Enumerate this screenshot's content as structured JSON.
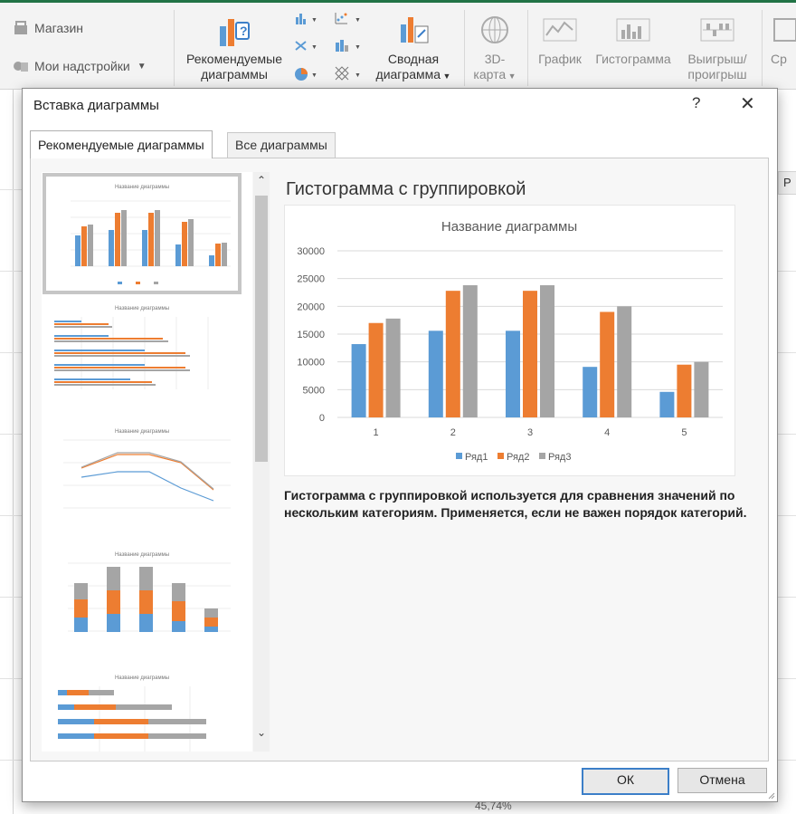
{
  "ribbon": {
    "store_label": "Магазин",
    "addins_label": "Мои надстройки",
    "recommended_line1": "Рекомендуемые",
    "recommended_line2": "диаграммы",
    "pivot_line1": "Сводная",
    "pivot_line2": "диаграмма",
    "map3d_line1": "3D-",
    "map3d_line2": "карта",
    "line_spark": "График",
    "column_spark": "Гистограмма",
    "winloss_line1": "Выигрыш/",
    "winloss_line2": "проигрыш",
    "slicer_partial": "Ср"
  },
  "sheet": {
    "right_letter": "Р",
    "bottom_partial": "45,74%"
  },
  "dialog": {
    "title": "Вставка диаграммы",
    "help": "?",
    "close": "✕",
    "tabs": [
      "Рекомендуемые диаграммы",
      "Все диаграммы"
    ],
    "preview_title": "Гистограмма с группировкой",
    "description": "Гистограмма с группировкой используется для сравнения значений по нескольким категориям. Применяется, если не важен порядок категорий.",
    "ok": "ОК",
    "cancel": "Отмена",
    "thumb_title": "Название диаграммы"
  },
  "colors": {
    "series1": "#5b9bd5",
    "series2": "#ed7d31",
    "series3": "#a5a5a5",
    "ok_border": "#3c7fc8"
  },
  "chart_data": {
    "type": "bar",
    "title": "Название диаграммы",
    "categories": [
      "1",
      "2",
      "3",
      "4",
      "5"
    ],
    "series": [
      {
        "name": "Ряд1",
        "values": [
          13200,
          15600,
          15600,
          9100,
          4600
        ]
      },
      {
        "name": "Ряд2",
        "values": [
          17000,
          22800,
          22800,
          19000,
          9500
        ]
      },
      {
        "name": "Ряд3",
        "values": [
          17800,
          23800,
          23800,
          20000,
          10000
        ]
      }
    ],
    "yticks": [
      "0",
      "5000",
      "10000",
      "15000",
      "20000",
      "25000",
      "30000"
    ],
    "ylim": [
      0,
      30000
    ],
    "legend": "bottom",
    "grid": true
  }
}
